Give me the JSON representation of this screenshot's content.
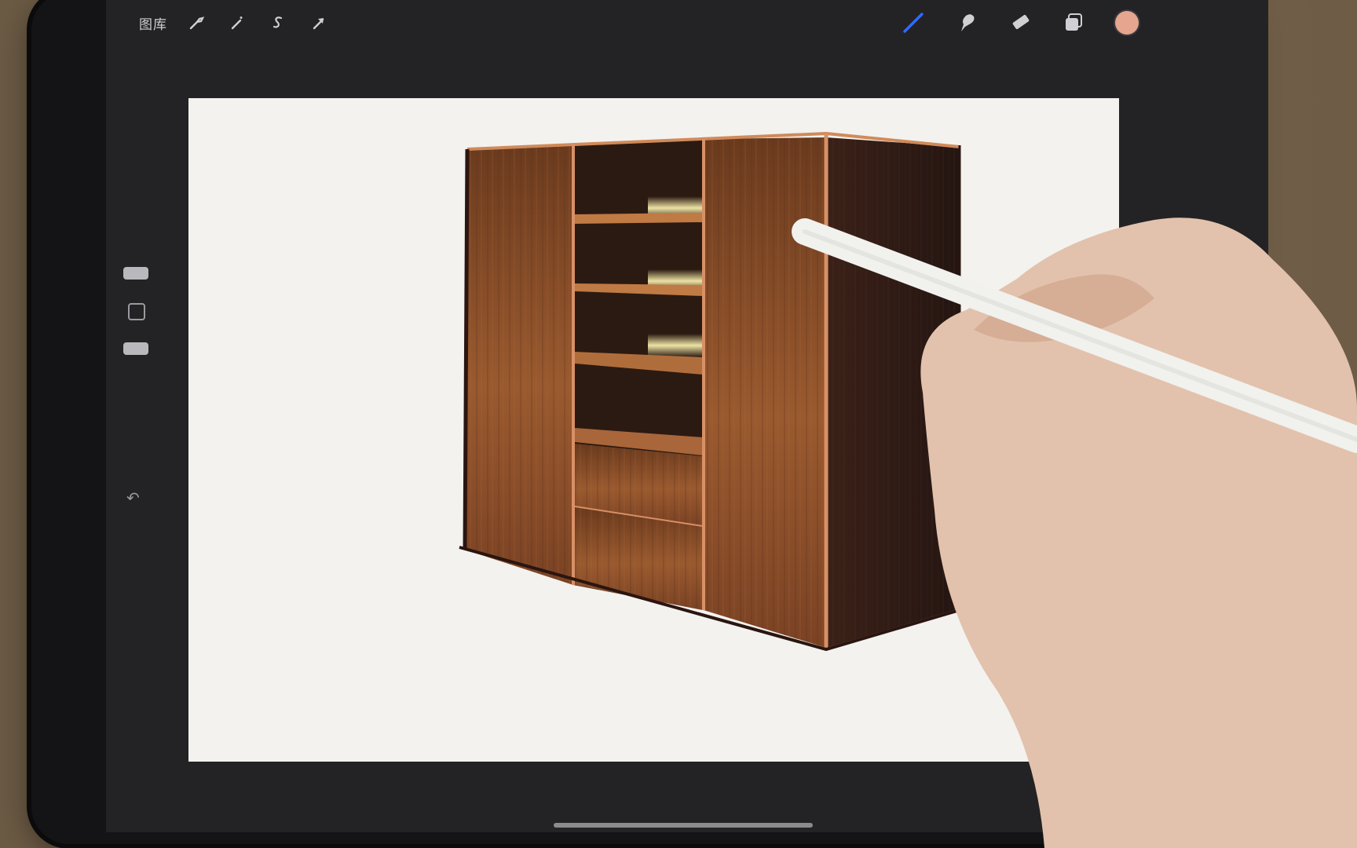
{
  "toolbar": {
    "gallery_label": "图库",
    "left_tools": [
      {
        "name": "wrench-icon"
      },
      {
        "name": "magic-wand-icon"
      },
      {
        "name": "selection-s-icon"
      },
      {
        "name": "transform-arrow-icon"
      }
    ],
    "right_tools": [
      {
        "name": "brush-icon",
        "active": true
      },
      {
        "name": "smudge-icon"
      },
      {
        "name": "eraser-icon"
      },
      {
        "name": "layers-icon"
      }
    ],
    "current_color": "#e6a58e",
    "active_tool_color": "#2f6bff"
  },
  "sidebar": {
    "undo_glyph": "↶"
  },
  "artwork": {
    "subject": "wooden-wardrobe-sketch"
  }
}
